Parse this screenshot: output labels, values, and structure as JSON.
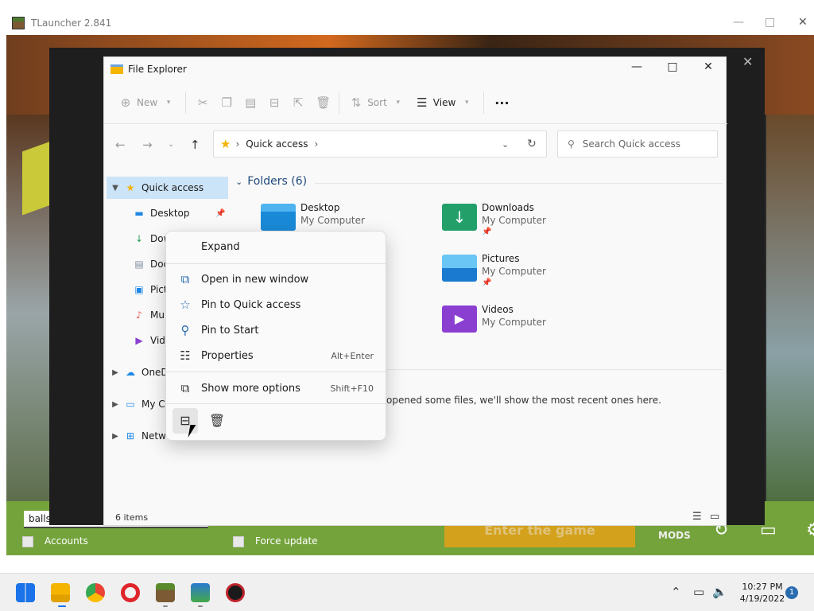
{
  "tlauncher": {
    "title": "TLauncher 2.841",
    "account_value": "balls",
    "accounts_label": "Accounts",
    "force_update_label": "Force update",
    "enter_game_label": "Enter the game",
    "mods_label": "MODS"
  },
  "explorer": {
    "title": "File Explorer",
    "commands": {
      "new": "New",
      "sort": "Sort",
      "view": "View",
      "more": "···"
    },
    "address": "Quick access",
    "search_placeholder": "Search Quick access",
    "nav": [
      {
        "label": "Quick access"
      },
      {
        "label": "Desktop"
      },
      {
        "label": "Dow"
      },
      {
        "label": "Doc"
      },
      {
        "label": "Pict"
      },
      {
        "label": "Mu"
      },
      {
        "label": "Vide"
      },
      {
        "label": "OneD"
      },
      {
        "label": "My C"
      },
      {
        "label": "Netw"
      }
    ],
    "folders_header": "Folders (6)",
    "folders": [
      {
        "name": "Desktop",
        "location": "My Computer"
      },
      {
        "name": "Downloads",
        "location": "My Computer"
      },
      {
        "name": "Pictures",
        "location": "My Computer"
      },
      {
        "name": "Videos",
        "location": "My Computer"
      }
    ],
    "recent_text": "opened some files, we'll show the most recent ones here.",
    "status": "6 items"
  },
  "context_menu": {
    "items": [
      {
        "label": "Expand",
        "shortcut": ""
      },
      {
        "label": "Open in new window",
        "shortcut": ""
      },
      {
        "label": "Pin to Quick access",
        "shortcut": ""
      },
      {
        "label": "Pin to Start",
        "shortcut": ""
      },
      {
        "label": "Properties",
        "shortcut": "Alt+Enter"
      },
      {
        "label": "Show more options",
        "shortcut": "Shift+F10"
      }
    ],
    "bottom_actions": [
      "rename-icon",
      "delete-icon"
    ]
  },
  "taskbar": {
    "time": "10:27 PM",
    "date": "4/19/2022",
    "notification_count": "1",
    "apps": [
      "start-icon",
      "file-explorer-icon",
      "chrome-icon",
      "opera-icon",
      "minecraft-icon",
      "tlauncher-icon",
      "app-icon"
    ]
  },
  "colors": {
    "accent": "#2b6cb0",
    "selected_nav": "#cce4f7",
    "launcher_green": "#74a33c",
    "enter_button": "#d3a11c"
  }
}
